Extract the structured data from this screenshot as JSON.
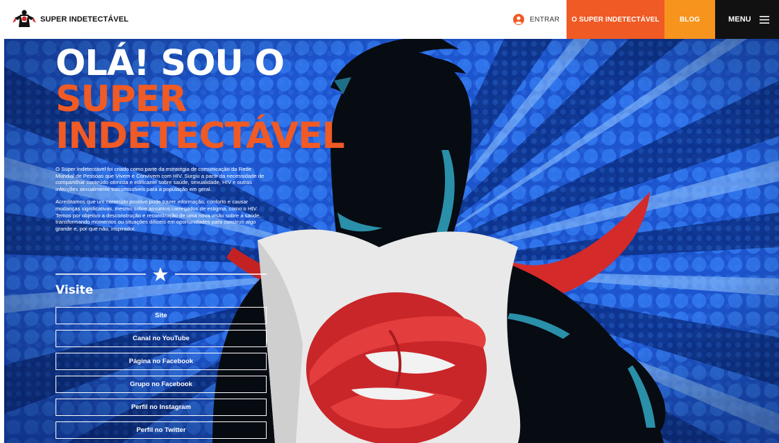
{
  "header": {
    "brand_name": "SUPER INDETECTÁVEL",
    "brand_logo_icon": "superhero-logo-icon",
    "login_icon": "user-avatar-icon",
    "login_label": "ENTRAR",
    "nav": [
      {
        "label": "O SUPER INDETECTÁVEL",
        "color": "#f05a24"
      },
      {
        "label": "BLOG",
        "color": "#f7941d"
      }
    ],
    "menu_label": "MENU",
    "menu_icon": "hamburger-icon",
    "menu_color": "#111111"
  },
  "hero": {
    "title_line1": "OLÁ! SOU O",
    "title_line2": "SUPER",
    "title_line3": "INDETECTÁVEL",
    "accent_color": "#f05a24",
    "background_color": "#1d5bd8",
    "paragraph1": "O Super Indetectável foi criado como parte da estratégia de comunicação da Rede Mundial de Pessoas que Vivem e Convivem com HIV. Surgiu a partir da necessidade de compartilhar conteúdo otimista e edificante sobre saúde, sexualidade, HIV e outras infecções sexualmente transmissíveis para a população em geral.",
    "paragraph2": "Acreditamos que um conteúdo positivo pode trazer informação, conforto e causar mudanças significativas, mesmo sobre assuntos carregados de estigma, como o HIV. Temos por objetivo a desconstrução e reconstrução de uma nova visão sobre a saúde, transformando momentos ou situações difíceis em oportunidades para construir algo grande e, por que não, inspirador.",
    "divider_icon": "star-icon",
    "visit_title": "Visite",
    "links": [
      {
        "label": "Site"
      },
      {
        "label": "Canal no YouTube"
      },
      {
        "label": "Página no Facebook"
      },
      {
        "label": "Grupo no Facebook"
      },
      {
        "label": "Perfil no Instagram"
      },
      {
        "label": "Perfil no Twitter"
      }
    ]
  }
}
